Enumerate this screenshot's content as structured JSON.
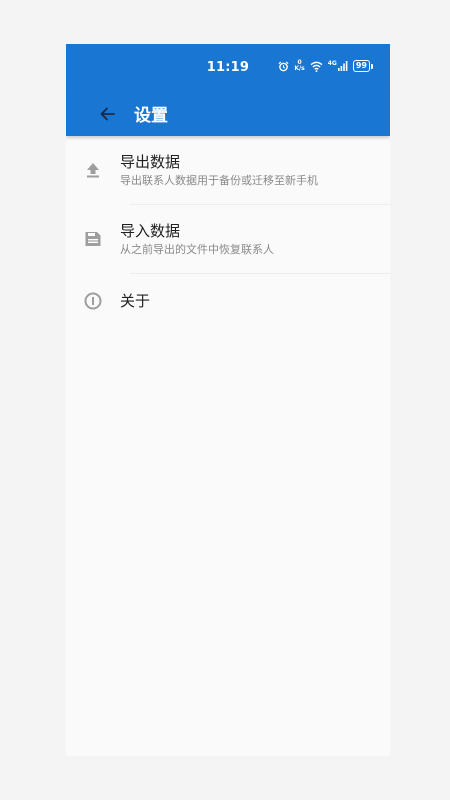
{
  "statusbar": {
    "time": "11:19",
    "speed_top": "0",
    "speed_unit": "K/s",
    "network": "4G",
    "battery": "99"
  },
  "appbar": {
    "title": "设置"
  },
  "settings": {
    "items": [
      {
        "icon": "upload-icon",
        "title": "导出数据",
        "subtitle": "导出联系人数据用于备份或迁移至新手机"
      },
      {
        "icon": "save-icon",
        "title": "导入数据",
        "subtitle": "从之前导出的文件中恢复联系人"
      },
      {
        "icon": "info-icon",
        "title": "关于"
      }
    ]
  },
  "colors": {
    "primary": "#1976d2",
    "background": "#fafafa",
    "icon_gray": "#9e9e9e",
    "text_primary": "#212121",
    "text_secondary": "#8a8a8a"
  }
}
